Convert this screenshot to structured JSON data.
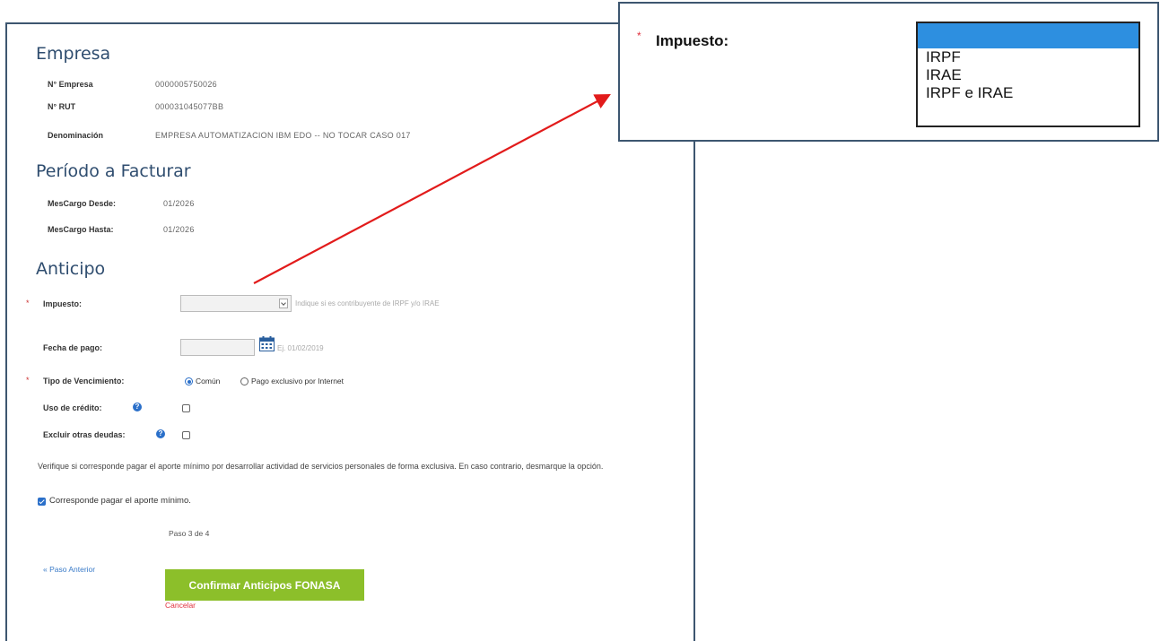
{
  "empresa": {
    "title": "Empresa",
    "fields": [
      {
        "label": "N° Empresa",
        "value": "0000005750026"
      },
      {
        "label": "N° RUT",
        "value": "000031045077BB"
      },
      {
        "label": "Denominación",
        "value": "EMPRESA AUTOMATIZACION IBM EDO -- NO TOCAR CASO 017"
      }
    ]
  },
  "periodo": {
    "title": "Período a Facturar",
    "fields": [
      {
        "label": "MesCargo Desde:",
        "value": "01/2026"
      },
      {
        "label": "MesCargo Hasta:",
        "value": "01/2026"
      }
    ]
  },
  "anticipo": {
    "title": "Anticipo",
    "required_mark": "*",
    "impuesto_label": "Impuesto:",
    "impuesto_hint": "Indique si es contribuyente de IRPF y/o IRAE",
    "fecha_label": "Fecha de pago:",
    "fecha_hint": "Ej. 01/02/2019",
    "tipo_label": "Tipo de Vencimiento:",
    "tipo_options": [
      "Común",
      "Pago exclusivo por Internet"
    ],
    "tipo_selected": "Común",
    "uso_credito_label": "Uso de crédito:",
    "excluir_label": "Excluir otras deudas:",
    "help_glyph": "?"
  },
  "aporte": {
    "text": "Verifique si corresponde pagar el aporte mínimo por desarrollar actividad de servicios personales de forma exclusiva. En caso contrario, desmarque la opción.",
    "check_label": "Corresponde pagar el aporte mínimo.",
    "checked": true
  },
  "footer": {
    "step": "Paso 3 de 4",
    "back": "« Paso Anterior",
    "confirm": "Confirmar Anticipos FONASA",
    "cancel": "Cancelar"
  },
  "zoom": {
    "required_mark": "*",
    "label": "Impuesto:",
    "options": [
      "",
      "IRPF",
      "IRAE",
      "IRPF e IRAE"
    ]
  },
  "colors": {
    "accent": "#2a6fc9",
    "title": "#2f4d6f",
    "confirm_button": "#8cbf2a",
    "cancel": "#e0303d",
    "arrow": "#e21b1b",
    "dropdown_selected": "#2d8fe0"
  },
  "icons": [
    "calendar-icon",
    "help-icon",
    "chevron-down-icon",
    "annotation-arrow"
  ]
}
